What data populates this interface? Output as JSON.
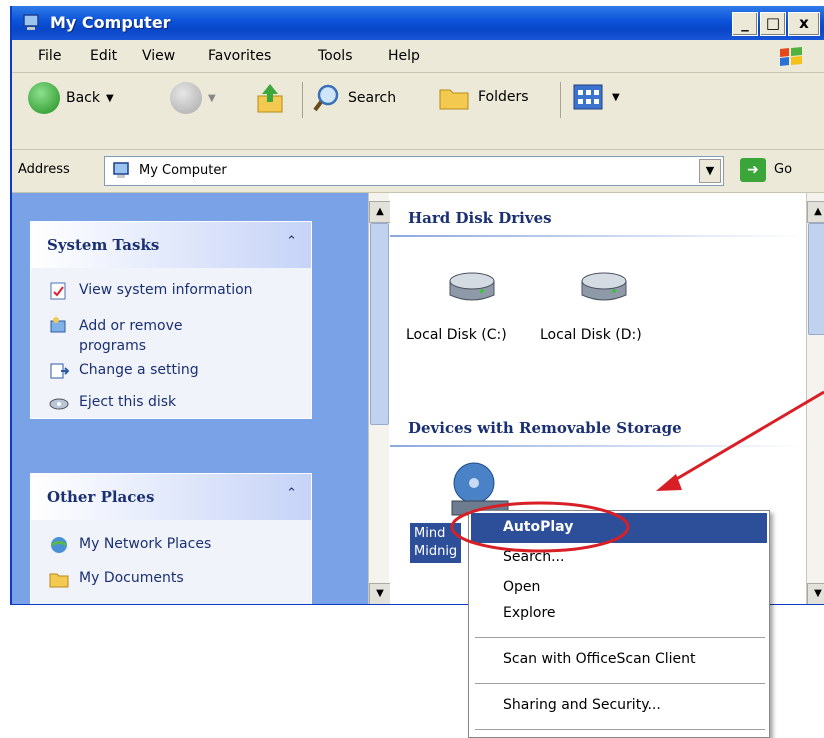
{
  "window": {
    "title": "My Computer",
    "min_label": "_",
    "max_label": "□",
    "close_label": "x"
  },
  "menubar": {
    "items": [
      "File",
      "Edit",
      "View",
      "Favorites",
      "Tools",
      "Help"
    ]
  },
  "toolbar": {
    "back_label": "Back",
    "search_label": "Search",
    "folders_label": "Folders"
  },
  "addressbar": {
    "label": "Address",
    "value": "My Computer",
    "go_label": "Go"
  },
  "left_pane": {
    "system_tasks": {
      "title": "System Tasks",
      "items": [
        "View system information",
        "Add or remove",
        "programs",
        "Change a setting",
        "Eject this disk"
      ]
    },
    "other_places": {
      "title": "Other Places",
      "items": [
        "My Network Places",
        "My Documents"
      ]
    }
  },
  "right_pane": {
    "hard_disks": {
      "title": "Hard Disk Drives",
      "drives": [
        "Local Disk (C:)",
        "Local Disk (D:)"
      ]
    },
    "removable": {
      "title": "Devices with Removable Storage",
      "device_label_1": "Mind",
      "device_label_2": "Midnig"
    }
  },
  "context_menu": {
    "items": [
      "AutoPlay",
      "Search...",
      "Open",
      "Explore",
      "Scan with OfficeScan Client",
      "Sharing and Security..."
    ]
  },
  "colors": {
    "titlebar": "#0b52d8",
    "left_pane": "#7aa2e6",
    "highlight": "#2d4f9a",
    "annotation": "#d81f26"
  }
}
